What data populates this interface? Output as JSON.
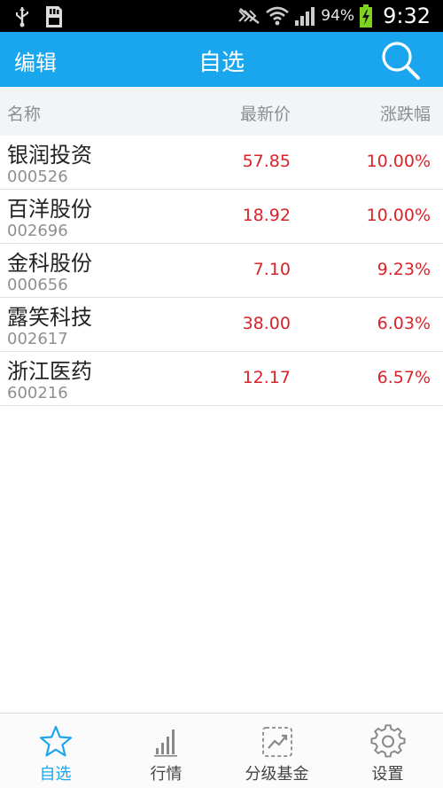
{
  "status_bar": {
    "battery_percent": "94%",
    "time": "9:32",
    "icons": [
      "usb-icon",
      "sd-card-icon",
      "mute-icon",
      "wifi-icon",
      "signal-icon",
      "battery-charging-icon"
    ]
  },
  "header": {
    "edit_label": "编辑",
    "title": "自选",
    "search_icon": "search-icon"
  },
  "columns": {
    "name": "名称",
    "price": "最新价",
    "change": "涨跌幅"
  },
  "stocks": [
    {
      "name": "银润投资",
      "code": "000526",
      "price": "57.85",
      "change": "10.00%"
    },
    {
      "name": "百洋股份",
      "code": "002696",
      "price": "18.92",
      "change": "10.00%"
    },
    {
      "name": "金科股份",
      "code": "000656",
      "price": "7.10",
      "change": "9.23%"
    },
    {
      "name": "露笑科技",
      "code": "002617",
      "price": "38.00",
      "change": "6.03%"
    },
    {
      "name": "浙江医药",
      "code": "600216",
      "price": "12.17",
      "change": "6.57%"
    }
  ],
  "bottom_nav": [
    {
      "label": "自选",
      "icon": "star-icon",
      "active": true
    },
    {
      "label": "行情",
      "icon": "bar-chart-icon",
      "active": false
    },
    {
      "label": "分级基金",
      "icon": "trend-icon",
      "active": false
    },
    {
      "label": "设置",
      "icon": "gear-icon",
      "active": false
    }
  ],
  "colors": {
    "accent": "#1aa6ee",
    "up": "#d8232a",
    "status_bar": "#000000"
  }
}
